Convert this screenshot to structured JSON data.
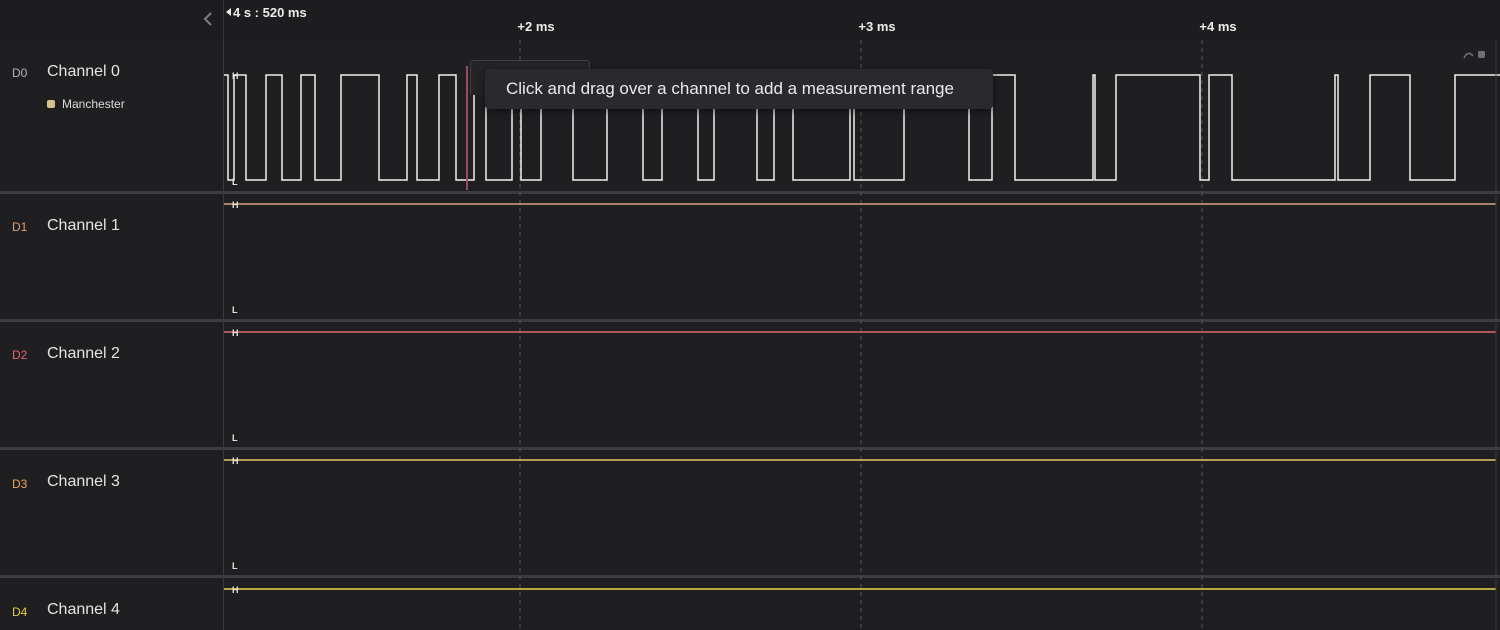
{
  "header": {
    "time_origin": "4 s : 520 ms",
    "ticks": [
      {
        "label": "+2 ms"
      },
      {
        "label": "+3 ms"
      },
      {
        "label": "+4 ms"
      }
    ]
  },
  "channels": [
    {
      "id": "D0",
      "name": "Channel 0",
      "color": "#b4b4b8",
      "trace_color": "#f0f0f0",
      "level": "H",
      "analyzer": {
        "name": "Manchester",
        "color": "#d7c38a"
      }
    },
    {
      "id": "D1",
      "name": "Channel 1",
      "color": "#d8a37a",
      "trace_color": "#d9a384",
      "level": "H"
    },
    {
      "id": "D2",
      "name": "Channel 2",
      "color": "#e0646b",
      "trace_color": "#e06a6e",
      "level": "H"
    },
    {
      "id": "D3",
      "name": "Channel 3",
      "color": "#e9a55a",
      "trace_color": "#eac56a",
      "level": "H"
    },
    {
      "id": "D4",
      "name": "Channel 4",
      "color": "#e4cc4a",
      "trace_color": "#ecd84c",
      "level": "H"
    }
  ],
  "level_labels": {
    "high": "H",
    "low": "L"
  },
  "tooltip": {
    "text": "Click and drag over a channel to add a measurement range"
  },
  "icons": {
    "collapse": "chevron-left-icon",
    "corner": "loop-icon"
  }
}
